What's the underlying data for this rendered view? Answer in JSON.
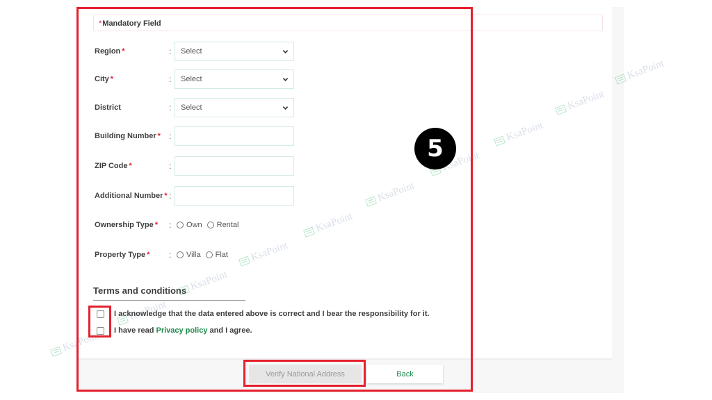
{
  "mandatory_note": {
    "star": "*",
    "text": "Mandatory Field"
  },
  "fields": [
    {
      "label": "Region",
      "required": true,
      "type": "select",
      "value": "Select"
    },
    {
      "label": "City",
      "required": true,
      "type": "select",
      "value": "Select"
    },
    {
      "label": "District",
      "required": false,
      "type": "select",
      "value": "Select"
    },
    {
      "label": "Building Number",
      "required": true,
      "type": "text",
      "value": ""
    },
    {
      "label": "ZIP Code",
      "required": true,
      "type": "text",
      "value": ""
    },
    {
      "label": "Additional Number",
      "required": true,
      "type": "text",
      "value": ""
    }
  ],
  "ownership": {
    "label": "Ownership Type",
    "required": true,
    "options": [
      "Own",
      "Rental"
    ]
  },
  "property": {
    "label": "Property Type",
    "required": true,
    "options": [
      "Villa",
      "Flat"
    ]
  },
  "colon": ":",
  "required_mark": "*",
  "terms": {
    "title": "Terms and conditions",
    "ack_text": "I acknowledge that the data entered above is correct and I bear the responsibility for it.",
    "privacy_prefix": "I have read",
    "privacy_link": "Privacy policy",
    "privacy_suffix": "and I agree.",
    "ack_checked": false,
    "privacy_checked": false
  },
  "buttons": {
    "verify": "Verify National Address",
    "back": "Back"
  },
  "annotation": {
    "step_number": "5",
    "highlight_color": "#e5202e"
  },
  "watermark": {
    "text": "KsaPoint"
  },
  "colors": {
    "accent_green": "#1e8a4c",
    "required_red": "#e0203a",
    "field_border": "#d3ece3"
  }
}
